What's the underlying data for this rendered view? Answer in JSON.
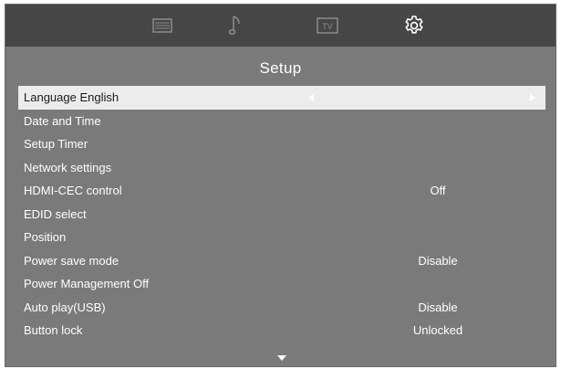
{
  "top_bar": {
    "icons": [
      {
        "name": "picture-icon"
      },
      {
        "name": "sound-icon"
      },
      {
        "name": "tv-icon",
        "text": "TV"
      },
      {
        "name": "settings-gear-icon"
      }
    ]
  },
  "page": {
    "title": "Setup"
  },
  "menu": {
    "items": [
      {
        "label": "Language English",
        "value": ""
      },
      {
        "label": "Date and Time",
        "value": ""
      },
      {
        "label": "Setup Timer",
        "value": ""
      },
      {
        "label": "Network settings",
        "value": ""
      },
      {
        "label": "HDMI-CEC control",
        "value": "Off"
      },
      {
        "label": "EDID select",
        "value": ""
      },
      {
        "label": "Position",
        "value": ""
      },
      {
        "label": "Power save mode",
        "value": "Disable"
      },
      {
        "label": "Power Management Off",
        "value": ""
      },
      {
        "label": "Auto play(USB)",
        "value": "Disable"
      },
      {
        "label": "Button lock",
        "value": "Unlocked"
      }
    ]
  },
  "colors": {
    "panel": "#7a7a7a",
    "top_bar": "#464646",
    "selected_row": "#ececec",
    "icon_inactive": "#8c8c8c",
    "icon_active": "#ffffff"
  }
}
